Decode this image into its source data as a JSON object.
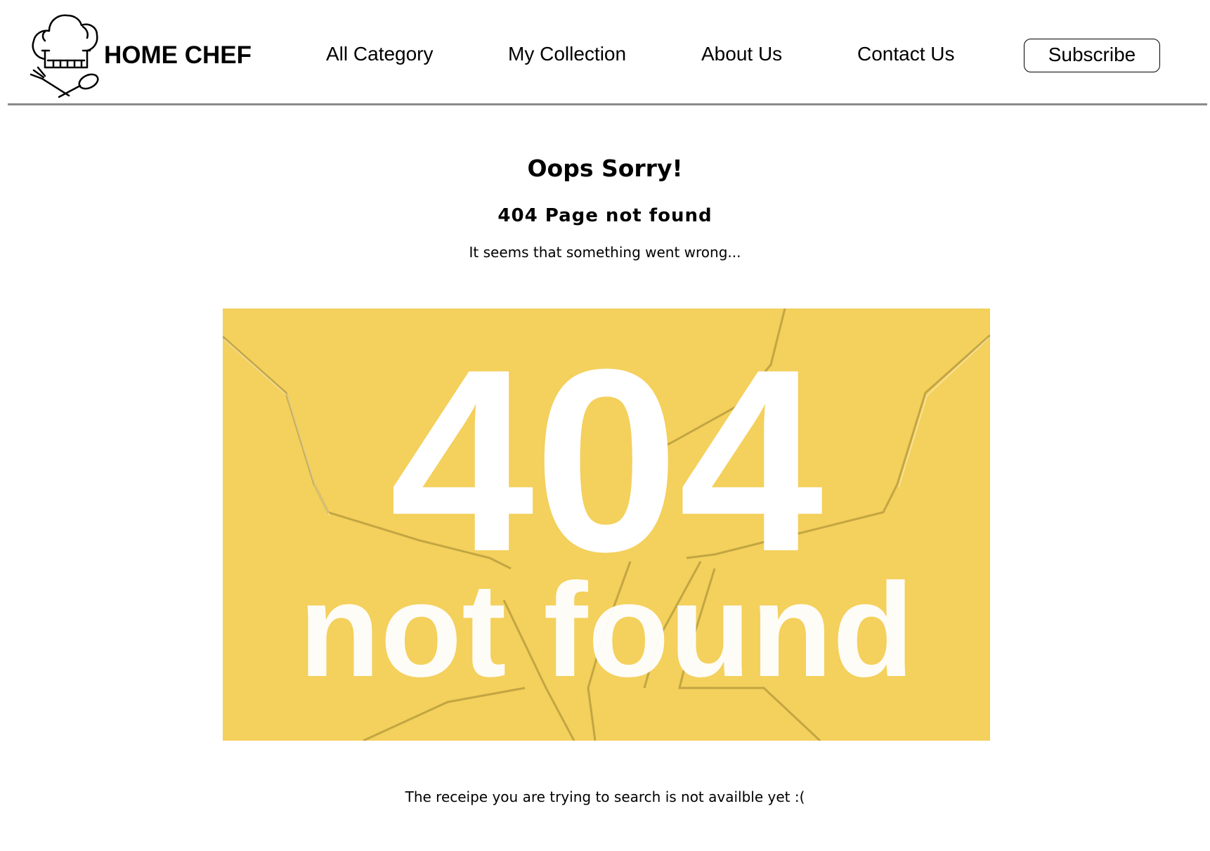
{
  "header": {
    "brand": "HOME CHEF",
    "nav": [
      {
        "label": "All Category"
      },
      {
        "label": "My Collection"
      },
      {
        "label": "About Us"
      },
      {
        "label": "Contact Us"
      }
    ],
    "subscribe_label": "Subscribe"
  },
  "main": {
    "title": "Oops Sorry!",
    "subtitle": "404 Page not found",
    "lead": "It seems that something went wrong...",
    "banner": {
      "code": "404",
      "caption": "not found",
      "background_color": "#f4d05c",
      "text_color": "#ffffff"
    },
    "footer_note": "The receipe you are trying to search is not availble yet :("
  },
  "icons": {
    "logo": "chef-hat-with-fork-and-spoon-icon"
  }
}
